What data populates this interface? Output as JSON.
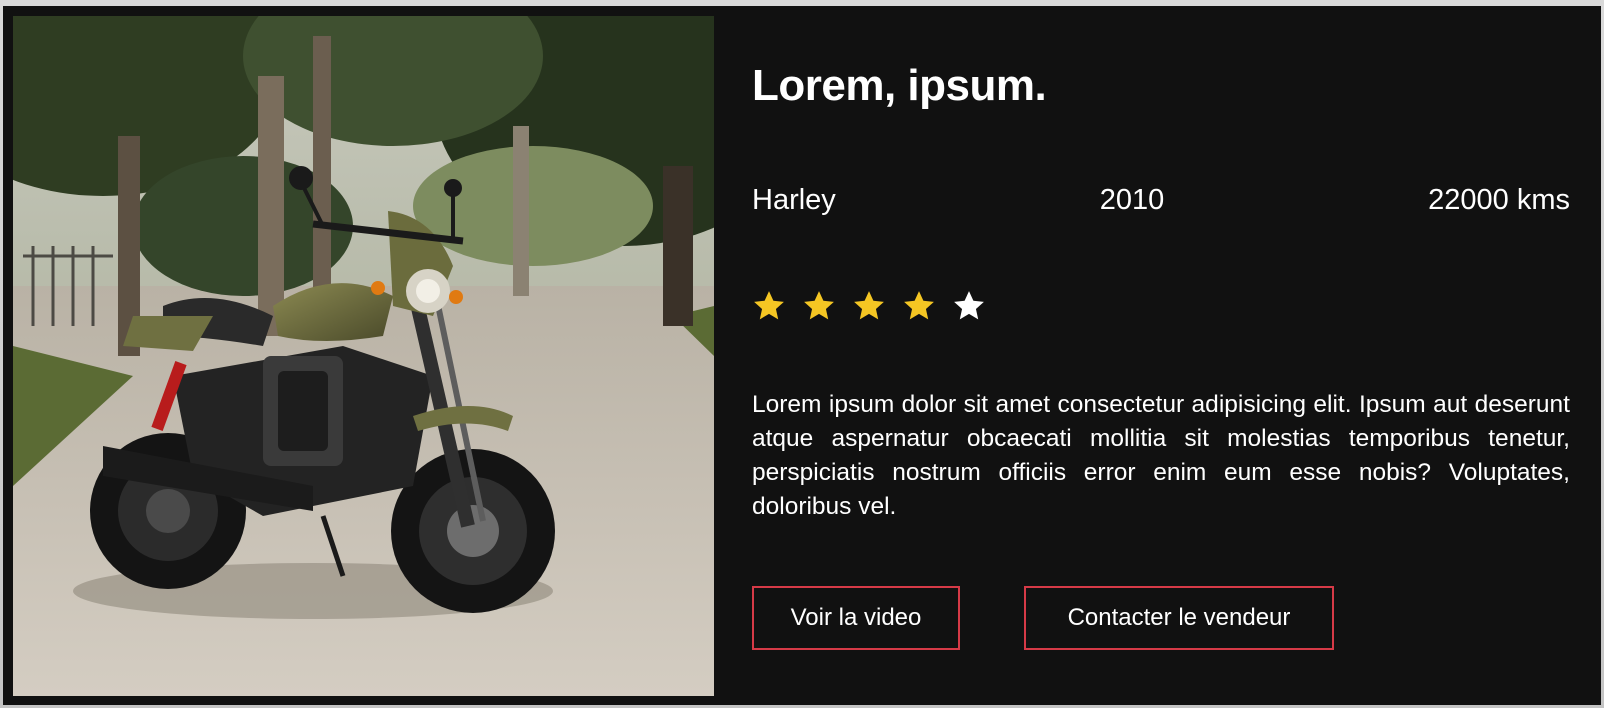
{
  "listing": {
    "title": "Lorem, ipsum.",
    "brand": "Harley",
    "year": "2010",
    "mileage": "22000 kms",
    "rating": {
      "value": 4,
      "max": 5,
      "filled_color": "#f5c623",
      "empty_color": "#ffffff"
    },
    "description": "Lorem ipsum dolor sit amet consectetur adipisicing elit. Ipsum aut deserunt atque aspernatur obcaecati mollitia sit molestias temporibus tenetur, perspiciatis nostrum officiis error enim eum esse nobis? Voluptates, doloribus vel.",
    "image_icon": "motorcycle-photo"
  },
  "actions": {
    "video_label": "Voir la video",
    "contact_label": "Contacter le vendeur",
    "border_color": "#d63a47"
  },
  "theme": {
    "card_background": "#111111",
    "text_color": "#ffffff"
  }
}
